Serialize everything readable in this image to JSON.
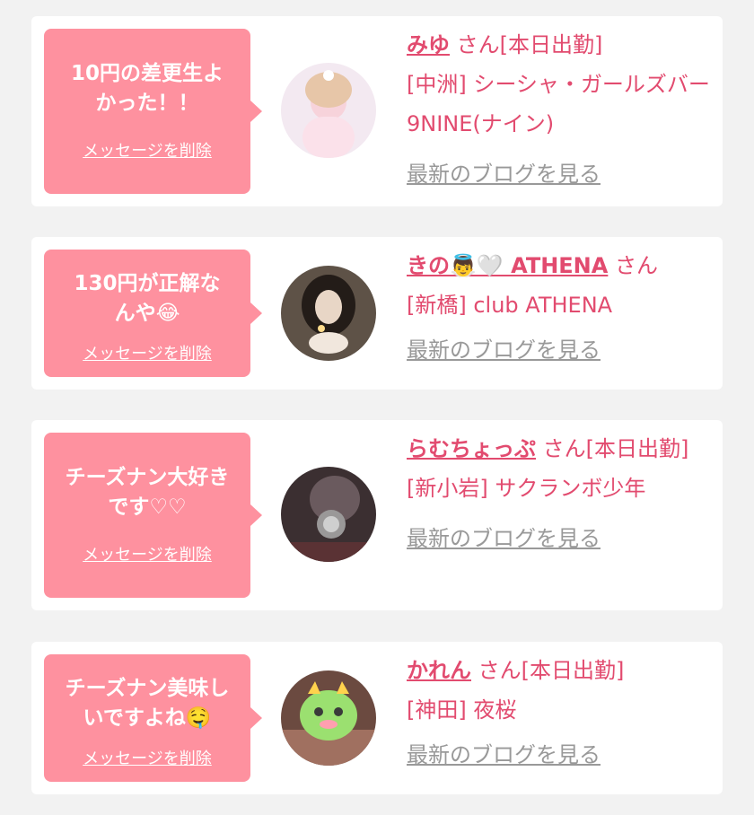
{
  "cards": [
    {
      "message": "10円の差更生よかった！！",
      "delete_label": "メッセージを削除",
      "name": "みゆ",
      "suffix": " さん[本日出勤]",
      "shop": "[中洲] シーシャ・ガールズバー 9NINE(ナイン)",
      "blog_label": "最新のブログを見る"
    },
    {
      "message": "130円が正解なんや😂",
      "delete_label": "メッセージを削除",
      "name": "きの👼🤍 ATHENA",
      "suffix": " さん",
      "shop": "[新橋] club ATHENA",
      "blog_label": "最新のブログを見る"
    },
    {
      "message": "チーズナン大好きです♡♡",
      "delete_label": "メッセージを削除",
      "name": "らむちょっぷ",
      "suffix": " さん[本日出勤]",
      "shop": "[新小岩] サクランボ少年",
      "blog_label": "最新のブログを見る"
    },
    {
      "message": "チーズナン美味しいですよね🤤",
      "delete_label": "メッセージを削除",
      "name": "かれん",
      "suffix": " さん[本日出勤]",
      "shop": "[神田] 夜桜",
      "blog_label": "最新のブログを見る"
    }
  ],
  "colors": {
    "bubble": "#fe919f",
    "name": "#e24b6f",
    "blog_link": "#999999",
    "background": "#f2f2f2"
  }
}
